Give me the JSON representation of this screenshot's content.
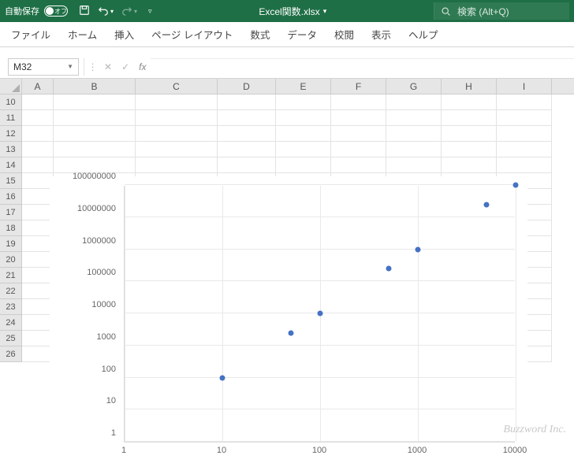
{
  "titlebar": {
    "autosave_label": "自動保存",
    "autosave_state": "オフ",
    "doc_name": "Excel関数.xlsx",
    "search_placeholder": "検索 (Alt+Q)"
  },
  "ribbon": {
    "tabs": [
      "ファイル",
      "ホーム",
      "挿入",
      "ページ レイアウト",
      "数式",
      "データ",
      "校閲",
      "表示",
      "ヘルプ"
    ]
  },
  "formula_bar": {
    "namebox": "M32",
    "fx_label": "fx",
    "formula": ""
  },
  "sheet": {
    "columns": [
      {
        "label": "A",
        "width": 40
      },
      {
        "label": "B",
        "width": 104
      },
      {
        "label": "C",
        "width": 104
      },
      {
        "label": "D",
        "width": 74
      },
      {
        "label": "E",
        "width": 70
      },
      {
        "label": "F",
        "width": 70
      },
      {
        "label": "G",
        "width": 70
      },
      {
        "label": "H",
        "width": 70
      },
      {
        "label": "I",
        "width": 70
      }
    ],
    "row_start": 10,
    "row_end": 26
  },
  "chart_data": {
    "type": "scatter",
    "x": [
      10,
      50,
      100,
      500,
      1000,
      5000,
      10000
    ],
    "y": [
      100,
      2500,
      10000,
      250000,
      1000000,
      25000000,
      100000000
    ],
    "xscale": "log",
    "yscale": "log",
    "xlim": [
      1,
      10000
    ],
    "ylim": [
      1,
      100000000
    ],
    "xticks": [
      1,
      10,
      100,
      1000,
      10000
    ],
    "yticks": [
      1,
      10,
      100,
      1000,
      10000,
      100000,
      1000000,
      10000000,
      100000000
    ],
    "grid": true,
    "marker_color": "#4472c4"
  },
  "watermark": "Buzzword Inc."
}
